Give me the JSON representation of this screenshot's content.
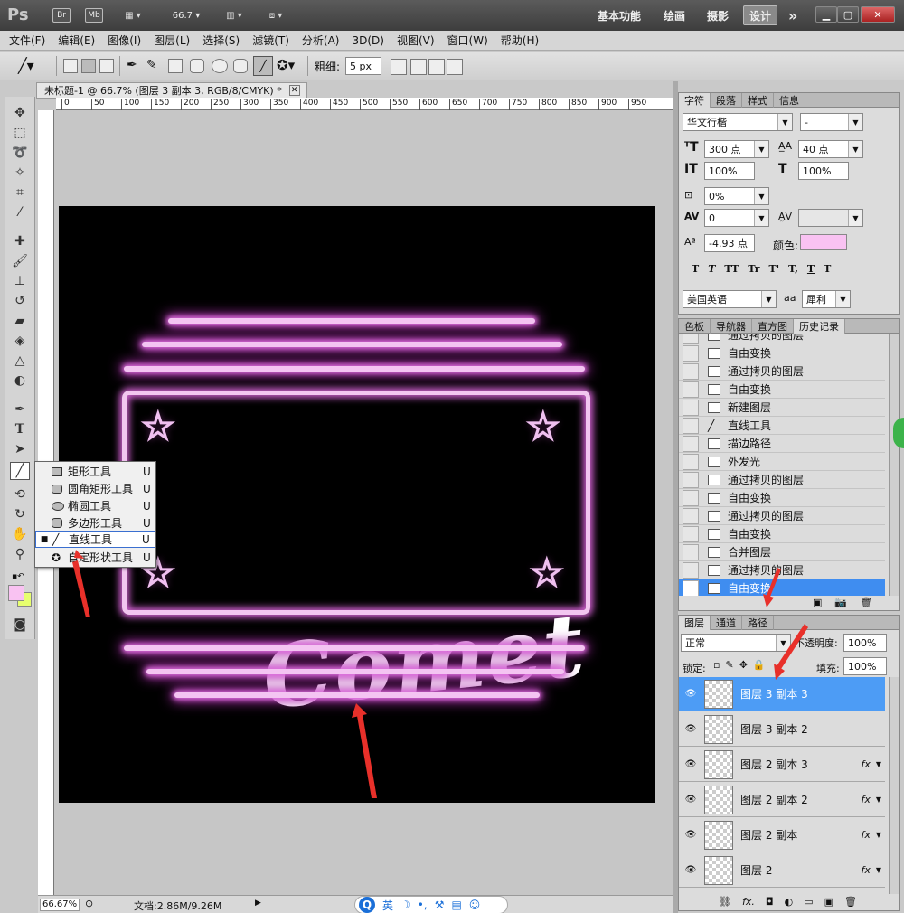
{
  "app": {
    "logo": "Ps",
    "bridge": "Br",
    "minibridge": "Mb",
    "zoom_dropdown": "66.7",
    "workspaces": [
      "基本功能",
      "绘画",
      "摄影",
      "设计"
    ],
    "active_workspace": "设计",
    "more": "»"
  },
  "menu": [
    "文件(F)",
    "编辑(E)",
    "图像(I)",
    "图层(L)",
    "选择(S)",
    "滤镜(T)",
    "分析(A)",
    "3D(D)",
    "视图(V)",
    "窗口(W)",
    "帮助(H)"
  ],
  "options": {
    "weight_label": "粗细:",
    "weight_value": "5 px"
  },
  "document": {
    "tab_title": "未标题-1 @ 66.7% (图层 3 副本 3, RGB/8/CMYK) *",
    "ruler_ticks": [
      "0",
      "50",
      "100",
      "150",
      "200",
      "250",
      "300",
      "350",
      "400",
      "450",
      "500",
      "550",
      "600",
      "650",
      "700",
      "750",
      "800",
      "850",
      "900",
      "950"
    ],
    "artwork_text": "Comet"
  },
  "flyout": {
    "items": [
      {
        "label": "矩形工具",
        "key": "U"
      },
      {
        "label": "圆角矩形工具",
        "key": "U"
      },
      {
        "label": "椭圆工具",
        "key": "U"
      },
      {
        "label": "多边形工具",
        "key": "U"
      },
      {
        "label": "直线工具",
        "key": "U"
      },
      {
        "label": "自定形状工具",
        "key": "U"
      }
    ],
    "selected_index": 4
  },
  "status": {
    "zoom": "66.67%",
    "doc_size": "文档:2.86M/9.26M",
    "ime": "英"
  },
  "character_panel": {
    "tabs": [
      "字符",
      "段落",
      "样式",
      "信息"
    ],
    "font_family": "华文行楷",
    "font_style": "-",
    "size": "300 点",
    "leading": "40 点",
    "vscale": "100%",
    "hscale": "100%",
    "tracking_pct": "0%",
    "kerning": "0",
    "baseline": "-4.93 点",
    "color_label": "颜色:",
    "color": "#f9c2f2",
    "language": "美国英语",
    "aa_label": "aa",
    "antialias": "犀利",
    "style_buttons": [
      "T",
      "T",
      "TT",
      "Tr",
      "T'",
      "T,",
      "T",
      "Ŧ"
    ]
  },
  "history_panel": {
    "tabs": [
      "色板",
      "导航器",
      "直方图",
      "历史记录"
    ],
    "items": [
      "通过拷贝的图层",
      "自由变换",
      "通过拷贝的图层",
      "自由变换",
      "新建图层",
      "直线工具",
      "描边路径",
      "外发光",
      "通过拷贝的图层",
      "自由变换",
      "通过拷贝的图层",
      "自由变换",
      "合并图层",
      "通过拷贝的图层",
      "自由变换"
    ],
    "selected_index": 14
  },
  "layers_panel": {
    "tabs": [
      "图层",
      "通道",
      "路径"
    ],
    "blend_mode": "正常",
    "opacity_label": "不透明度:",
    "opacity": "100%",
    "lock_label": "锁定:",
    "fill_label": "填充:",
    "fill": "100%",
    "layers": [
      {
        "name": "图层 3 副本 3",
        "fx": ""
      },
      {
        "name": "图层 3 副本 2",
        "fx": ""
      },
      {
        "name": "图层 2 副本 3",
        "fx": "fx"
      },
      {
        "name": "图层 2 副本 2",
        "fx": "fx"
      },
      {
        "name": "图层 2 副本",
        "fx": "fx"
      },
      {
        "name": "图层 2",
        "fx": "fx"
      }
    ],
    "selected_index": 0
  },
  "colors": {
    "neon": "#f4c4f2",
    "glow": "#d060d0",
    "selection": "#3f8df0"
  }
}
